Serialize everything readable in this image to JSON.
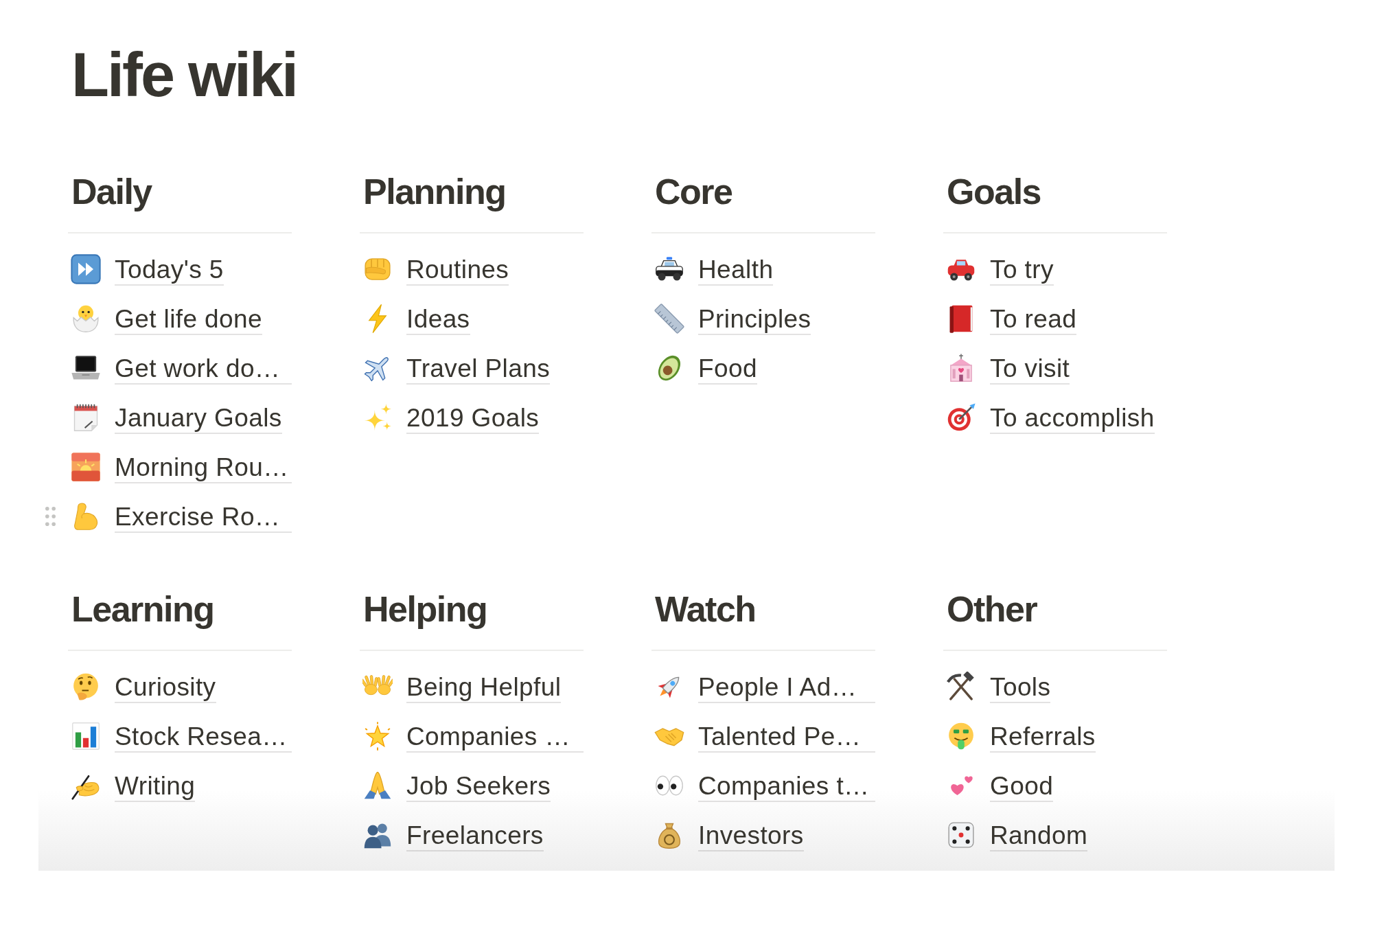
{
  "page": {
    "title": "Life wiki"
  },
  "sections": [
    {
      "heading": "Daily",
      "items": [
        {
          "label": "Today's 5",
          "truncated": false,
          "hovered": false
        },
        {
          "label": "Get life done",
          "truncated": false,
          "hovered": false
        },
        {
          "label": "Get work do…",
          "truncated": true,
          "hovered": false
        },
        {
          "label": "January Goals",
          "truncated": false,
          "hovered": false
        },
        {
          "label": "Morning Rou…",
          "truncated": true,
          "hovered": false
        },
        {
          "label": "Exercise Ro…",
          "truncated": true,
          "hovered": true
        }
      ]
    },
    {
      "heading": "Planning",
      "items": [
        {
          "label": "Routines",
          "truncated": false,
          "hovered": false
        },
        {
          "label": "Ideas",
          "truncated": false,
          "hovered": false
        },
        {
          "label": "Travel Plans",
          "truncated": false,
          "hovered": false
        },
        {
          "label": "2019 Goals",
          "truncated": false,
          "hovered": false
        }
      ]
    },
    {
      "heading": "Core",
      "items": [
        {
          "label": "Health",
          "truncated": false,
          "hovered": false
        },
        {
          "label": "Principles",
          "truncated": false,
          "hovered": false
        },
        {
          "label": "Food",
          "truncated": false,
          "hovered": false
        }
      ]
    },
    {
      "heading": "Goals",
      "items": [
        {
          "label": "To try",
          "truncated": false,
          "hovered": false
        },
        {
          "label": "To read",
          "truncated": false,
          "hovered": false
        },
        {
          "label": "To visit",
          "truncated": false,
          "hovered": false
        },
        {
          "label": "To accomplish",
          "truncated": false,
          "hovered": false
        }
      ]
    },
    {
      "heading": "Learning",
      "items": [
        {
          "label": "Curiosity",
          "truncated": false,
          "hovered": false
        },
        {
          "label": "Stock Resea…",
          "truncated": true,
          "hovered": false
        },
        {
          "label": "Writing",
          "truncated": false,
          "hovered": false
        }
      ]
    },
    {
      "heading": "Helping",
      "items": [
        {
          "label": "Being Helpful",
          "truncated": false,
          "hovered": false
        },
        {
          "label": "Companies …",
          "truncated": true,
          "hovered": false
        },
        {
          "label": "Job Seekers",
          "truncated": false,
          "hovered": false
        },
        {
          "label": "Freelancers",
          "truncated": false,
          "hovered": false
        }
      ]
    },
    {
      "heading": "Watch",
      "items": [
        {
          "label": "People I Ad…",
          "truncated": true,
          "hovered": false
        },
        {
          "label": "Talented Pe…",
          "truncated": true,
          "hovered": false
        },
        {
          "label": "Companies t…",
          "truncated": true,
          "hovered": false
        },
        {
          "label": "Investors",
          "truncated": false,
          "hovered": false
        }
      ]
    },
    {
      "heading": "Other",
      "items": [
        {
          "label": "Tools",
          "truncated": false,
          "hovered": false
        },
        {
          "label": "Referrals",
          "truncated": false,
          "hovered": false
        },
        {
          "label": "Good",
          "truncated": false,
          "hovered": false
        },
        {
          "label": "Random",
          "truncated": false,
          "hovered": false
        }
      ]
    }
  ]
}
